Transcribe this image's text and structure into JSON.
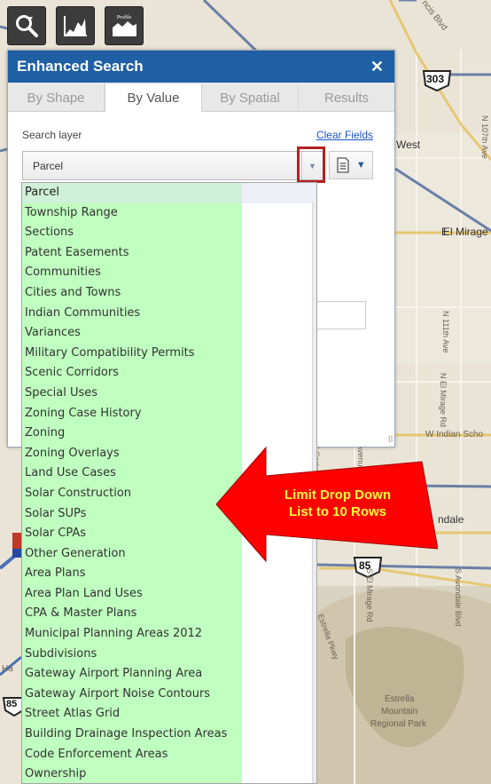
{
  "toolbar": {
    "search_icon": "magnifier-icon",
    "profile_icon": "profile-chart-icon",
    "profile2_icon": "profile-chart-icon",
    "profile2_tag": "Profile"
  },
  "panel": {
    "title": "Enhanced Search",
    "close_label": "✕",
    "tabs": [
      {
        "label": "By Shape",
        "active": false
      },
      {
        "label": "By Value",
        "active": true
      },
      {
        "label": "By Spatial",
        "active": false
      },
      {
        "label": "Results",
        "active": false
      }
    ],
    "search_layer_label": "Search layer",
    "clear_fields_label": "Clear Fields",
    "selected_layer": "Parcel"
  },
  "dropdown": {
    "items": [
      "Parcel",
      "Township Range",
      "Sections",
      "Patent Easements",
      "Communities",
      "Cities and Towns",
      "Indian Communities",
      "Variances",
      "Military Compatibility Permits",
      "Scenic Corridors",
      "Special Uses",
      "Zoning Case History",
      "Zoning",
      "Zoning Overlays",
      "Land Use Cases",
      "Solar Construction",
      "Solar SUPs",
      "Solar CPAs",
      "Other Generation",
      "Area Plans",
      "Area Plan Land Uses",
      "CPA & Master Plans",
      "Municipal Planning Areas 2012",
      "Subdivisions",
      "Gateway Airport Planning Area",
      "Gateway Airport Noise Contours",
      "Street Atlas Grid",
      "Building Drainage Inspection Areas",
      "Code Enforcement Areas",
      "Ownership"
    ]
  },
  "callout": {
    "line1": "Limit Drop Down",
    "line2": "List to 10 Rows",
    "color": "#ff0000"
  },
  "map": {
    "labels": {
      "ncis": "ncis Blvd",
      "west": "West",
      "el_mirage": "El Mirage",
      "n_111th": "N 111th Ave",
      "n_107th": "N 107th Ave",
      "n_el_mirage_rd": "N El Mirage Rd",
      "n_ave": "N 1 Ave",
      "w_indian": "W Indian Scho",
      "ndale": "ndale",
      "s_el_mirage": "S El Mirage Rd",
      "s_avondale": "S Avondale Blvd",
      "estrella_pkwy": "Estrella Pkwy",
      "estrella": "Estrella",
      "mountain": "Mountain",
      "regional_park": "Regional Park",
      "sarival": "S Sarival Ave",
      "avenue": "Avenue",
      "shield_303": "303",
      "shield_85": "85",
      "shield_85b": "85",
      "e": "E",
      "ha": "Ha"
    }
  }
}
